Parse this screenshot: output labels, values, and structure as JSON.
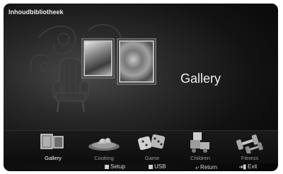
{
  "header": {
    "title": "Inhoudbibliotheek"
  },
  "main": {
    "selected_label": "Gallery"
  },
  "categories": [
    {
      "label": "Gallery",
      "icon": "gallery-icon",
      "selected": true
    },
    {
      "label": "Cooking",
      "icon": "cooking-icon",
      "selected": false
    },
    {
      "label": "Game",
      "icon": "dice-icon",
      "selected": false
    },
    {
      "label": "Children",
      "icon": "blocks-icon",
      "selected": false
    },
    {
      "label": "Fitness",
      "icon": "dumbbell-icon",
      "selected": false
    }
  ],
  "footer": {
    "setup": "Setup",
    "usb": "USB",
    "return": "Return",
    "exit": "Exit"
  },
  "colors": {
    "background": "#1a1a1a",
    "text": "#f0f0f0",
    "label_dim": "#9a9a9a"
  }
}
